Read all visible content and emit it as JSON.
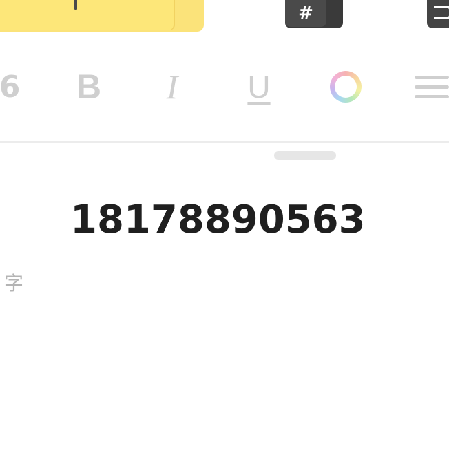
{
  "top_keys": {
    "hash_key_label": "#"
  },
  "format_bar": {
    "size_label": "6",
    "bold_label": "B",
    "italic_label": "I",
    "underline_label": "U"
  },
  "content": {
    "phone_number": "18178890563",
    "side_label": "字"
  }
}
